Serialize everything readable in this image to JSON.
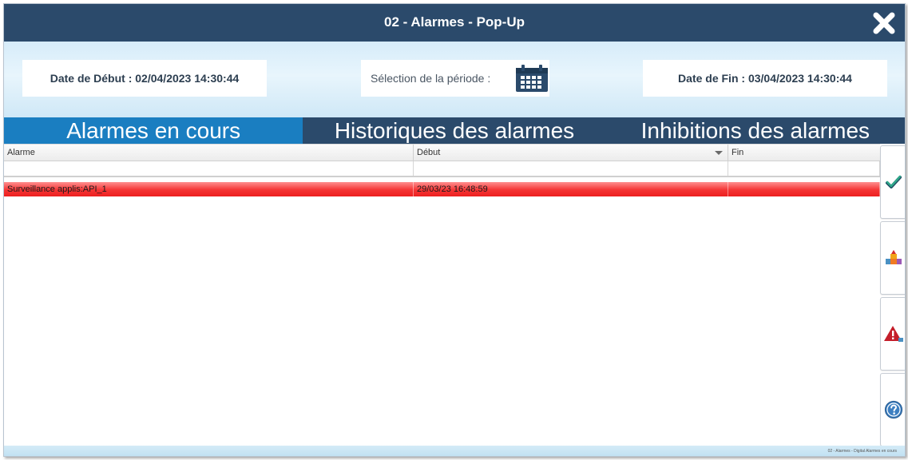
{
  "window": {
    "title": "02 - Alarmes - Pop-Up"
  },
  "filter": {
    "start_label": "Date de Début : 02/04/2023 14:30:44",
    "period_label": "Sélection de la période :",
    "end_label": "Date de Fin : 03/04/2023 14:30:44"
  },
  "tabs": [
    {
      "label": "Alarmes en cours",
      "active": true
    },
    {
      "label": "Historiques des alarmes",
      "active": false
    },
    {
      "label": "Inhibitions des alarmes",
      "active": false
    }
  ],
  "table": {
    "columns": [
      "Alarme",
      "Début",
      "Fin"
    ],
    "rows": [
      {
        "alarme": "Surveillance applis:API_1",
        "debut": "29/03/23 16:48:59",
        "fin": ""
      }
    ]
  },
  "sidebar": {
    "buttons": [
      {
        "icon": "checkmark-icon"
      },
      {
        "icon": "stacked-blocks-icon"
      },
      {
        "icon": "warning-triangle-icon"
      },
      {
        "icon": "help-icon"
      }
    ]
  },
  "statusbar": {
    "text": "02 - Alarmes - Digital Alarmes en cours"
  },
  "colors": {
    "title_bar": "#2b4a6b",
    "active_tab": "#1a7ec1",
    "alarm_row": "#f53434"
  }
}
